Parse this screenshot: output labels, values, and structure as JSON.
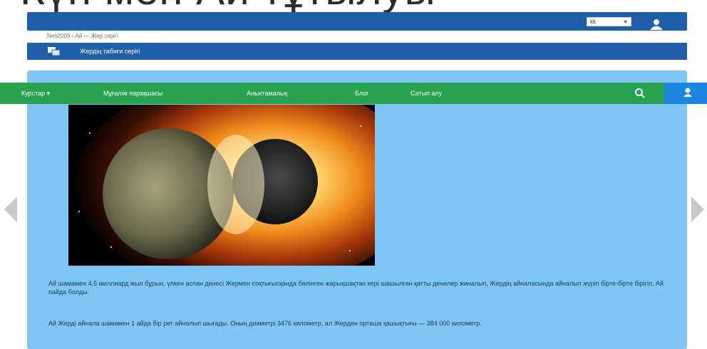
{
  "page": {
    "big_title": "Күн мен Ай тұтылуы"
  },
  "header": {
    "language": "kk",
    "user_icon": "user-icon"
  },
  "breadcrumb": "Neo2005 › Ай — Жер серігі",
  "section": {
    "icon": "slides-icon",
    "title": "Жердің табиғи серігі"
  },
  "nav": {
    "items": [
      {
        "label": "Курстар ▾"
      },
      {
        "label": "Мұғалім парақшасы"
      },
      {
        "label": "Аныктамалық"
      },
      {
        "label": "Блог"
      },
      {
        "label": "Сатып алу"
      }
    ],
    "search_icon": "search-icon",
    "user_icon": "user-icon"
  },
  "slide": {
    "image_alt": "Жерге ұқсас ғаламшар мен аспан денесінің соқтығысуы",
    "paragraph1": "Ай шамамен 4,5 миллиард жыл бұрын, үлкен аспан денесі Жермен соқтығысқанда бөлінген жарықшақтан кері шашылған қатты денелер жиналып, Жердің айналасында айналып жүріп бірте-бірте бірігіп, Ай пайда болды.",
    "paragraph2": "Ай Жерді айнала шамамен 1 айда бір рет айналып шығады. Оның диаметрі 3476 километр, ал Жерден орташа қашықтығы — 384 000 километр."
  },
  "controls": {
    "prev_icon": "arrow-left-icon",
    "next_icon": "arrow-right-icon"
  },
  "colors": {
    "header_blue": "#1f5ea8",
    "nav_green": "#27a24e",
    "slide_bg": "#7fc6f6",
    "user_blue": "#1c86e0"
  }
}
